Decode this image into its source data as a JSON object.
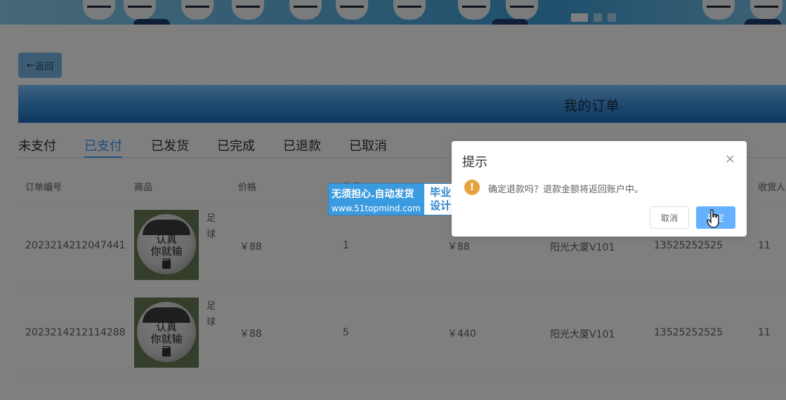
{
  "back_button": {
    "arrow": "←",
    "label": "返回"
  },
  "page_title": "我的订单",
  "tabs": [
    {
      "label": "未支付",
      "active": false
    },
    {
      "label": "已支付",
      "active": true
    },
    {
      "label": "已发货",
      "active": false
    },
    {
      "label": "已完成",
      "active": false
    },
    {
      "label": "已退款",
      "active": false
    },
    {
      "label": "已取消",
      "active": false
    }
  ],
  "table": {
    "columns": [
      "订单编号",
      "商品",
      "价格",
      "数量",
      "",
      "",
      "",
      "收货人"
    ],
    "rows": [
      {
        "order_no": "2023214212047441",
        "product": "足球",
        "price": "￥88",
        "qty": "1",
        "total": "￥88",
        "address": "阳光大厦V101",
        "phone": "13525252525",
        "receiver": "11"
      },
      {
        "order_no": "2023214212114288",
        "product": "足球",
        "price": "￥88",
        "qty": "5",
        "total": "￥440",
        "address": "阳光大厦V101",
        "phone": "13525252525",
        "receiver": "11"
      }
    ],
    "thumb_ink": "认真\n你就输了"
  },
  "watermark": {
    "line1": "无须担心.自动发货",
    "line2": "www.51topmind.com",
    "badge": "毕业\n设计"
  },
  "dialog": {
    "title": "提示",
    "close": "×",
    "message": "确定退款吗？退款金额将返回账户中。",
    "cancel_label": "取消",
    "confirm_label": "确定",
    "icon": "warning-icon"
  },
  "colors": {
    "accent": "#409eff",
    "warning": "#e6a23c"
  }
}
